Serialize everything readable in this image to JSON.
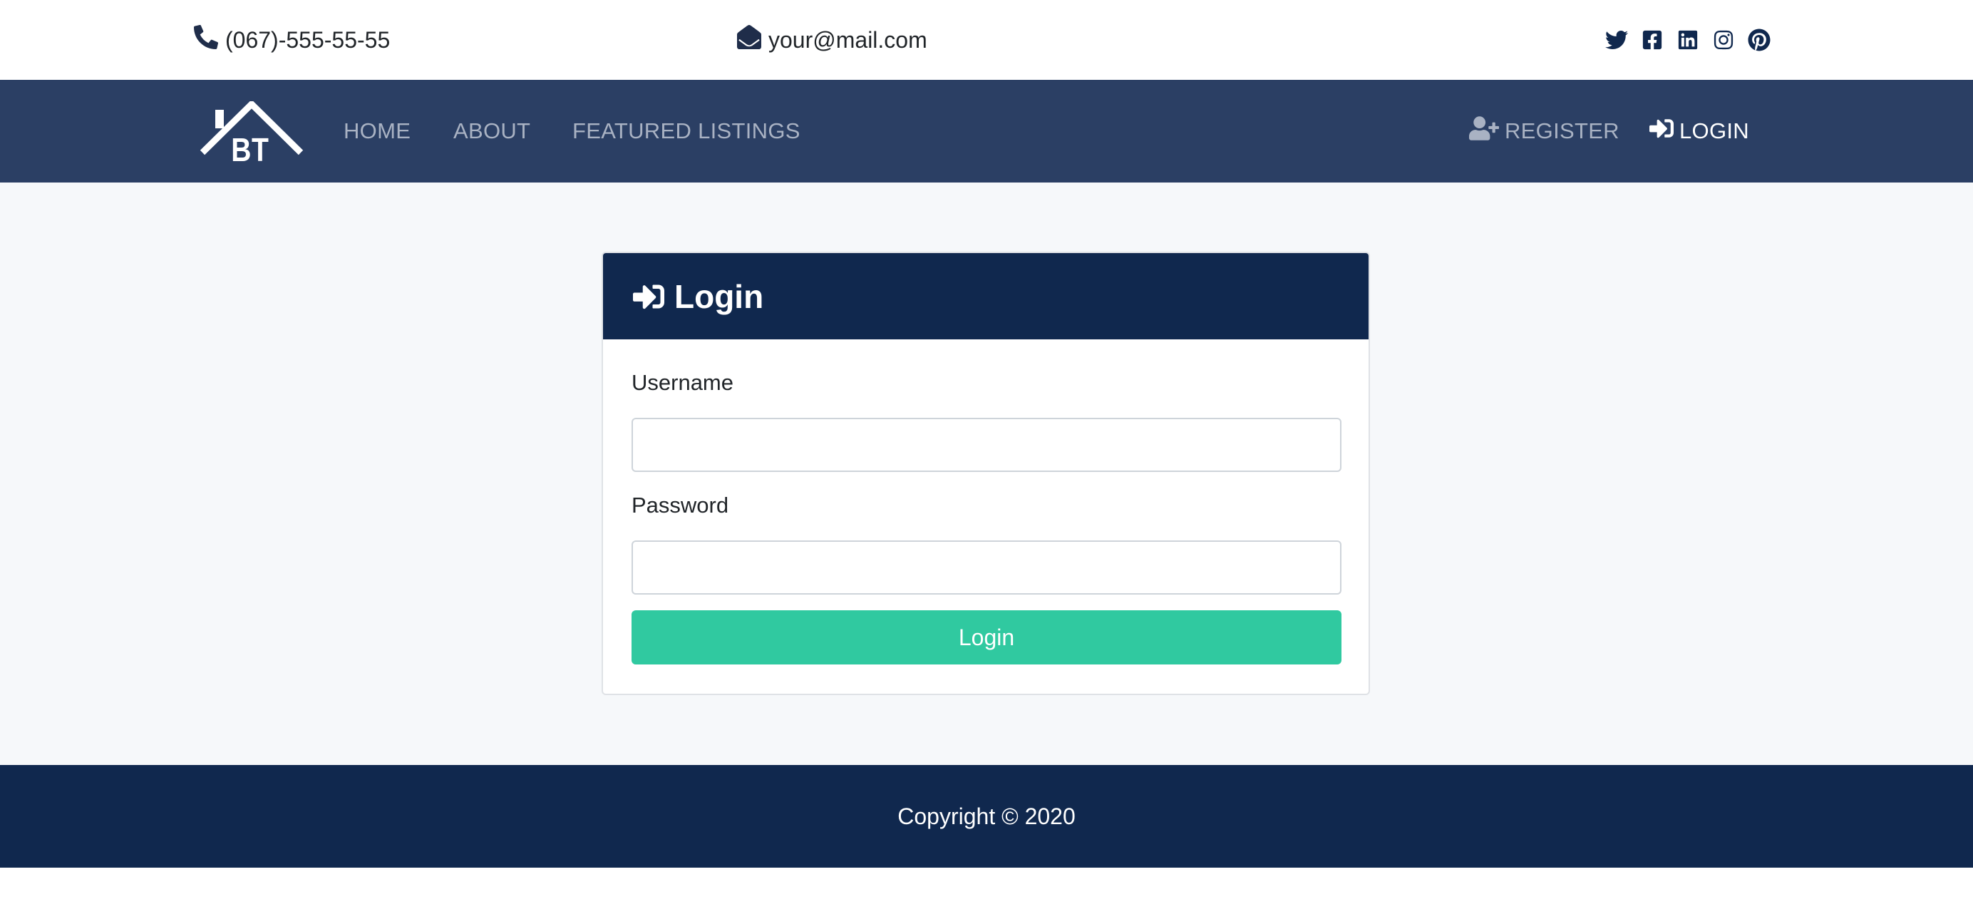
{
  "topbar": {
    "phone": "(067)-555-55-55",
    "email": "your@mail.com",
    "icons": {
      "phone": "phone-icon",
      "email": "envelope-open-icon"
    },
    "social": [
      "twitter-icon",
      "facebook-icon",
      "linkedin-icon",
      "instagram-icon",
      "pinterest-icon"
    ]
  },
  "navbar": {
    "links": [
      {
        "label": "HOME"
      },
      {
        "label": "ABOUT"
      },
      {
        "label": "FEATURED LISTINGS"
      }
    ],
    "register_label": "REGISTER",
    "login_label": "LOGIN",
    "icons": {
      "register": "user-plus-icon",
      "login": "sign-in-icon"
    }
  },
  "login_card": {
    "title": "Login",
    "username_label": "Username",
    "username_value": "",
    "password_label": "Password",
    "password_value": "",
    "submit_label": "Login"
  },
  "footer": {
    "copyright": "Copyright © 2020"
  },
  "colors": {
    "navbar_bg": "#2b3f64",
    "primary_dark": "#10284e",
    "accent_green": "#30c9a0",
    "nav_link": "#a9b2c3",
    "page_bg": "#f6f8fa"
  }
}
